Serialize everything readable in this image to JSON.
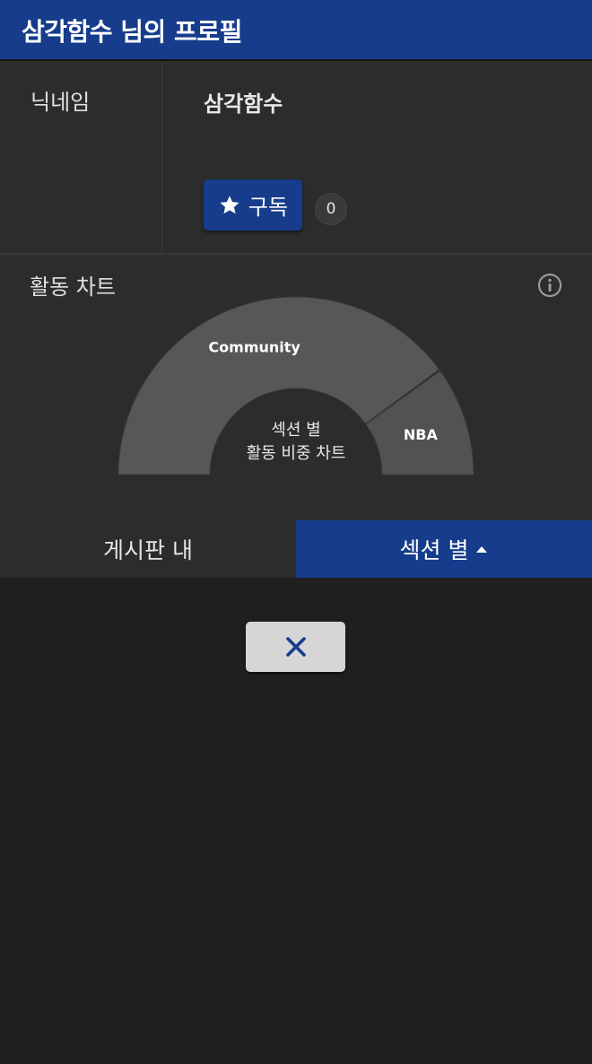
{
  "header": {
    "title": "삼각함수 님의 프로필"
  },
  "profile": {
    "nickname_label": "닉네임",
    "nickname_value": "삼각함수",
    "subscribe_label": "구독",
    "subscriber_count": "0"
  },
  "activity": {
    "title": "활동 차트",
    "center_line1": "섹션 별",
    "center_line2": "활동 비중 차트"
  },
  "chart_data": {
    "type": "pie",
    "labels": [
      "Community",
      "NBA"
    ],
    "values": [
      80,
      20
    ]
  },
  "tabs": [
    {
      "label": "게시판 내",
      "active": false
    },
    {
      "label": "섹션 별",
      "active": true
    }
  ],
  "colors": {
    "brand": "#163c8b",
    "panel": "#2c2c2c",
    "background": "#1f1f1f"
  },
  "icons": {
    "subscribe": "star-icon",
    "info": "info-icon",
    "tab_active": "caret-up-icon",
    "close": "close-icon"
  }
}
